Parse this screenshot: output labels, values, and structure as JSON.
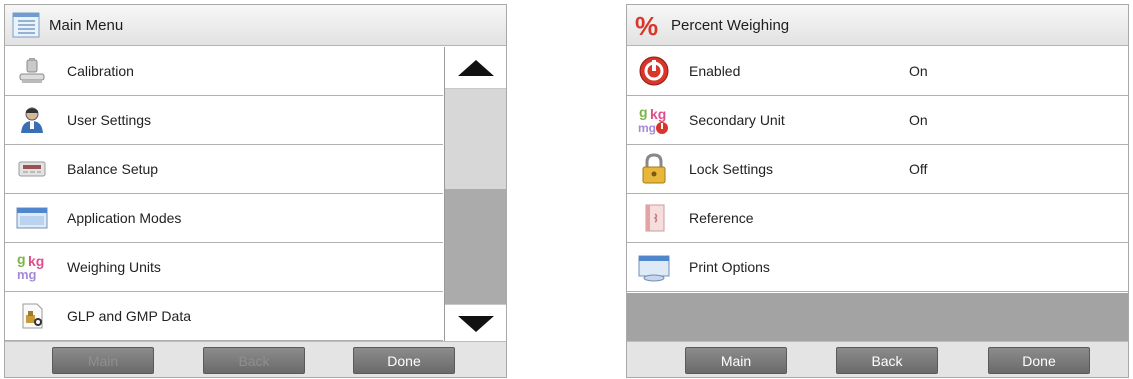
{
  "left_panel": {
    "title": "Main Menu",
    "title_icon": "menu-list-icon",
    "items": [
      {
        "label": "Calibration",
        "icon": "calibration-weight-icon"
      },
      {
        "label": "User Settings",
        "icon": "user-settings-icon"
      },
      {
        "label": "Balance Setup",
        "icon": "balance-setup-icon"
      },
      {
        "label": "Application Modes",
        "icon": "application-modes-icon"
      },
      {
        "label": "Weighing Units",
        "icon": "weighing-units-icon"
      },
      {
        "label": "GLP and GMP Data",
        "icon": "glp-gmp-data-icon"
      }
    ],
    "buttons": {
      "main": "Main",
      "back": "Back",
      "done": "Done"
    }
  },
  "right_panel": {
    "title": "Percent Weighing",
    "title_icon": "percent-icon",
    "items": [
      {
        "label": "Enabled",
        "value": "On",
        "icon": "power-icon"
      },
      {
        "label": "Secondary Unit",
        "value": "On",
        "icon": "secondary-unit-icon"
      },
      {
        "label": "Lock Settings",
        "value": "Off",
        "icon": "lock-icon"
      },
      {
        "label": "Reference",
        "value": "",
        "icon": "reference-icon"
      },
      {
        "label": "Print Options",
        "value": "",
        "icon": "print-options-icon"
      }
    ],
    "buttons": {
      "main": "Main",
      "back": "Back",
      "done": "Done"
    }
  },
  "colors": {
    "button_bg": "#777777",
    "disabled_text": "#8f8f8f",
    "percent_red": "#d9362b"
  }
}
